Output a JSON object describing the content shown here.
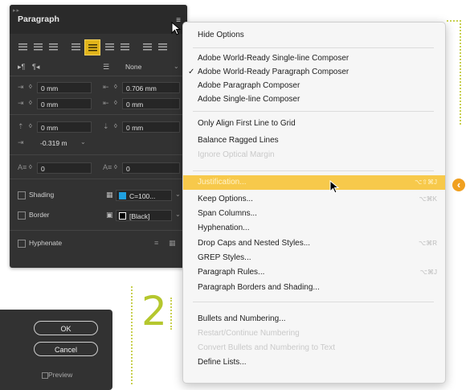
{
  "panel": {
    "title": "Paragraph",
    "drop_cap_select": "None",
    "left_indent": "0 mm",
    "right_indent": "0.706 mm",
    "first_line_left": "0 mm",
    "last_line_right": "0 mm",
    "space_before": "0 mm",
    "space_after": "0 mm",
    "first_indent": "-0.319 m",
    "drop_cap_lines": "0",
    "drop_cap_chars": "0",
    "shading_label": "Shading",
    "shading_color": "C=100...",
    "border_label": "Border",
    "border_color": "[Black]",
    "hyphenate_label": "Hyphenate",
    "colors": {
      "cyan": "#1fa0e0",
      "black": "#000000",
      "accent": "#e2b51b"
    }
  },
  "menu": {
    "items": [
      {
        "label": "Hide Options"
      },
      {
        "label": "Adobe World-Ready Single-line Composer"
      },
      {
        "label": "Adobe World-Ready Paragraph Composer",
        "checked": true
      },
      {
        "label": "Adobe Paragraph Composer"
      },
      {
        "label": "Adobe Single-line Composer"
      },
      {
        "label": "Only Align First Line to Grid"
      },
      {
        "label": "Balance Ragged Lines"
      },
      {
        "label": "Ignore Optical Margin",
        "disabled": true
      },
      {
        "label": "Justification...",
        "highlighted": true,
        "shortcut": "⌥⇧⌘J"
      },
      {
        "label": "Keep Options...",
        "shortcut": "⌥⌘K"
      },
      {
        "label": "Span Columns..."
      },
      {
        "label": "Hyphenation..."
      },
      {
        "label": "Drop Caps and Nested Styles...",
        "shortcut": "⌥⌘R"
      },
      {
        "label": "GREP Styles..."
      },
      {
        "label": "Paragraph Rules...",
        "shortcut": "⌥⌘J"
      },
      {
        "label": "Paragraph Borders and Shading..."
      },
      {
        "label": "Bullets and Numbering..."
      },
      {
        "label": "Restart/Continue Numbering",
        "disabled": true
      },
      {
        "label": "Convert Bullets and Numbering to Text",
        "disabled": true
      },
      {
        "label": "Define Lists..."
      }
    ]
  },
  "step_number": "2",
  "dialog": {
    "ok": "OK",
    "cancel": "Cancel",
    "preview": "Preview"
  }
}
